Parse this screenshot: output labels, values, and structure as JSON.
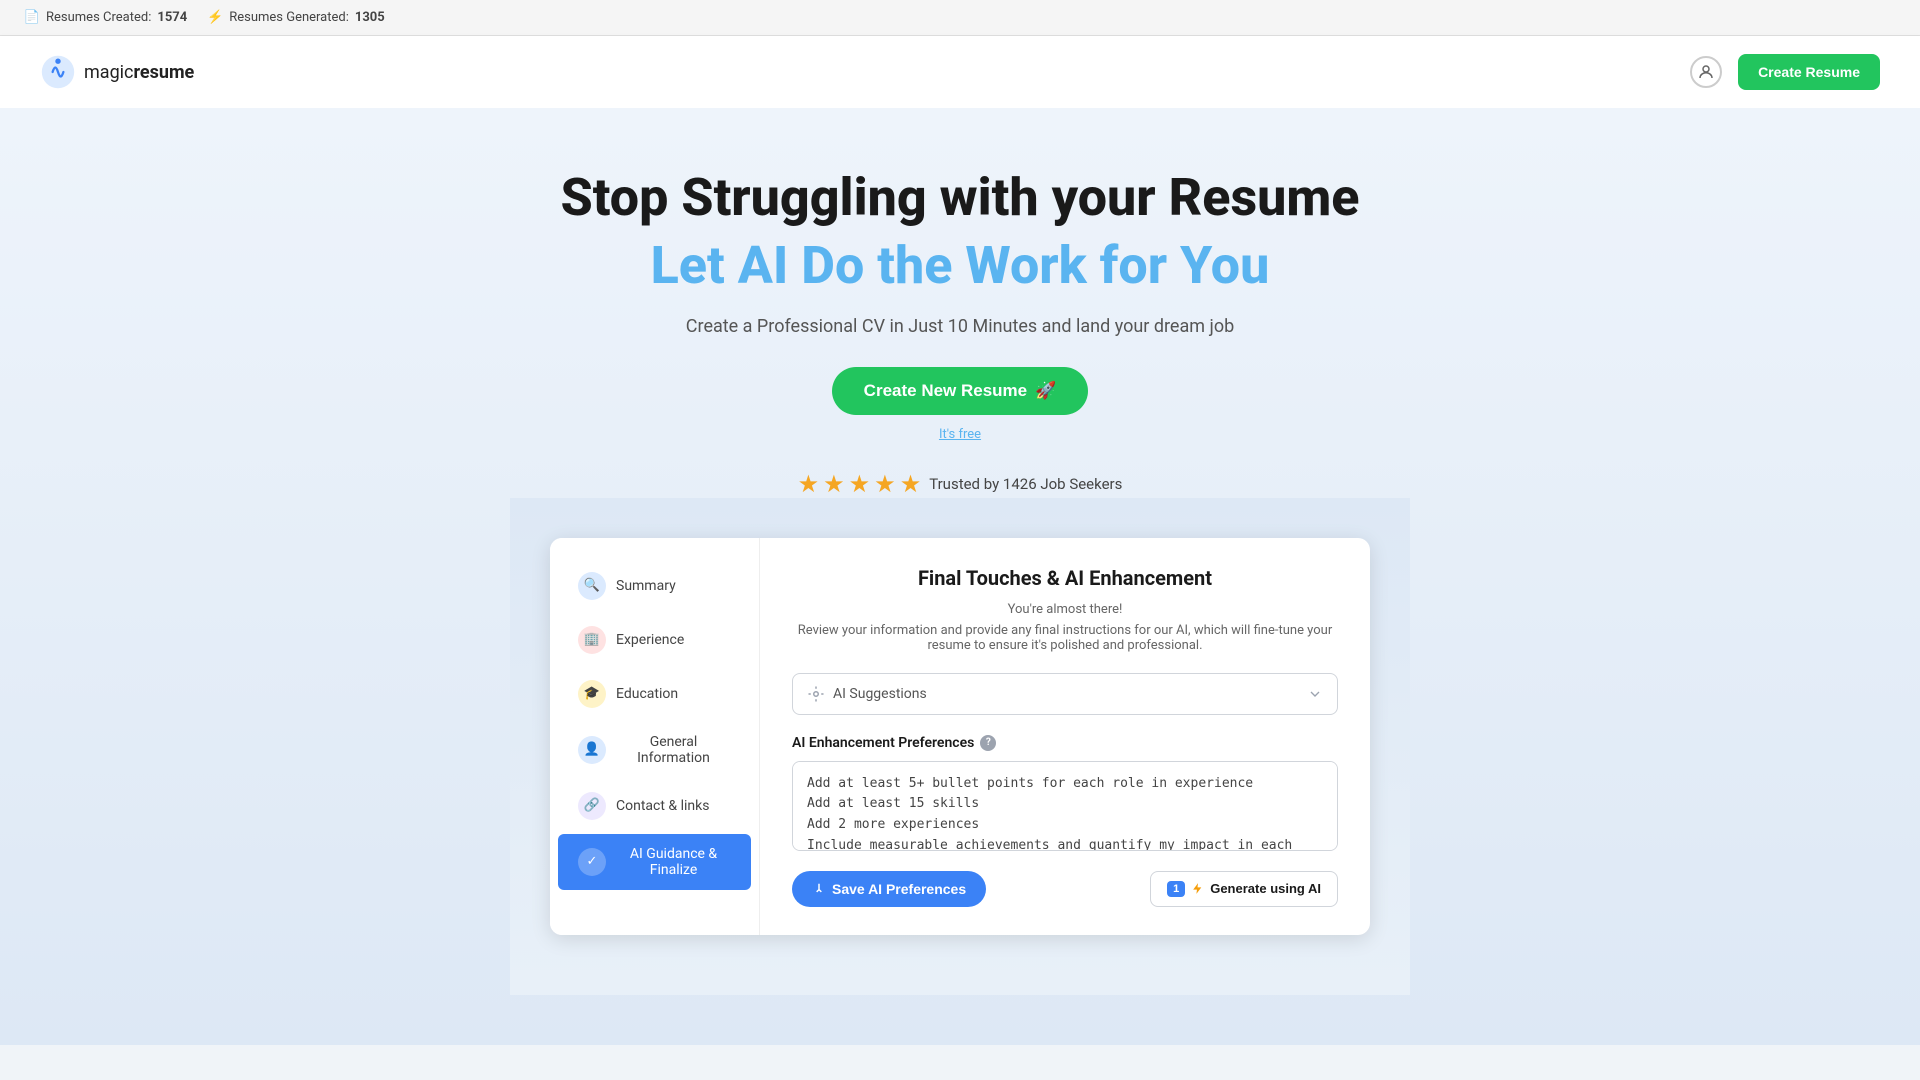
{
  "topbar": {
    "resumes_created_label": "Resumes Created:",
    "resumes_created_count": "1574",
    "resumes_generated_label": "Resumes Generated:",
    "resumes_generated_count": "1305"
  },
  "header": {
    "logo_text_magic": "magic",
    "logo_text_resume": "resume",
    "create_resume_btn": "Create Resume"
  },
  "hero": {
    "title_line1": "Stop Struggling with your Resume",
    "title_line2": "Let AI Do the Work for You",
    "subtitle": "Create a Professional CV in Just 10 Minutes and land your dream job",
    "cta_btn": "Create New Resume",
    "free_text": "It's free",
    "trusted_text": "Trusted by 1426 Job Seekers",
    "stars_count": 5
  },
  "sidebar": {
    "items": [
      {
        "id": "summary",
        "label": "Summary",
        "icon": "🔍"
      },
      {
        "id": "experience",
        "label": "Experience",
        "icon": "🏢"
      },
      {
        "id": "education",
        "label": "Education",
        "icon": "🎓"
      },
      {
        "id": "general",
        "label": "General Information",
        "icon": "👤"
      },
      {
        "id": "contact",
        "label": "Contact & links",
        "icon": "🔗"
      },
      {
        "id": "ai",
        "label": "AI Guidance & Finalize",
        "icon": "✓",
        "active": true
      }
    ]
  },
  "main": {
    "section_title": "Final Touches & AI Enhancement",
    "desc1": "You're almost there!",
    "desc2": "Review your information and provide any final instructions for our AI, which will fine-tune your resume to ensure it's polished and professional.",
    "ai_suggestions_label": "AI Suggestions",
    "preferences_label": "AI Enhancement Preferences",
    "preferences_text": "Add at least 5+ bullet points for each role in experience\nAdd at least 15 skills\nAdd 2 more experiences\nInclude measurable achievements and quantify my impact in each role",
    "save_btn": "Save AI Preferences",
    "generate_badge": "1",
    "generate_btn": "Generate using AI"
  }
}
